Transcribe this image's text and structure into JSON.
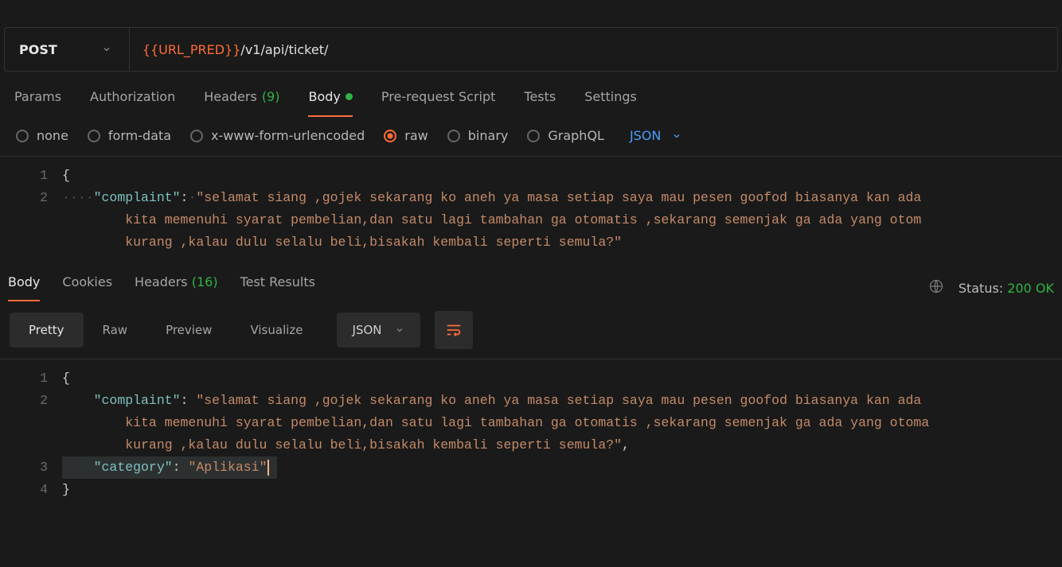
{
  "request": {
    "method": "POST",
    "url_var": "{{URL_PRED}}",
    "url_path": "/v1/api/ticket/"
  },
  "tabs": [
    {
      "label": "Params"
    },
    {
      "label": "Authorization"
    },
    {
      "label": "Headers",
      "count": "(9)"
    },
    {
      "label": "Body",
      "active": true,
      "dot": true
    },
    {
      "label": "Pre-request Script"
    },
    {
      "label": "Tests"
    },
    {
      "label": "Settings"
    }
  ],
  "body_types": [
    {
      "label": "none"
    },
    {
      "label": "form-data"
    },
    {
      "label": "x-www-form-urlencoded"
    },
    {
      "label": "raw",
      "selected": true
    },
    {
      "label": "binary"
    },
    {
      "label": "GraphQL"
    }
  ],
  "format_selector": "JSON",
  "request_body": {
    "lines": [
      "1",
      "2"
    ],
    "key": "\"complaint\"",
    "str_open": "\"selamat siang ,gojek sekarang ko aneh ya masa setiap saya mau pesen goofod biasanya kan ada ",
    "str_cont1": "kita memenuhi syarat pembelian,dan satu lagi tambahan ga otomatis ,sekarang semenjak ga ada yang otom",
    "str_cont2": "kurang ,kalau dulu selalu beli,bisakah kembali seperti semula?\""
  },
  "response_tabs": [
    {
      "label": "Body",
      "active": true
    },
    {
      "label": "Cookies"
    },
    {
      "label": "Headers",
      "count": "(16)"
    },
    {
      "label": "Test Results"
    }
  ],
  "response_status": {
    "label": "Status:",
    "value": "200 OK"
  },
  "view_tabs": [
    {
      "label": "Pretty",
      "active": true
    },
    {
      "label": "Raw"
    },
    {
      "label": "Preview"
    },
    {
      "label": "Visualize"
    }
  ],
  "response_format": "JSON",
  "response_body": {
    "lines": [
      "1",
      "2",
      "3",
      "4"
    ],
    "key1": "\"complaint\"",
    "val1a": "\"selamat siang ,gojek sekarang ko aneh ya masa setiap saya mau pesen goofod biasanya kan ada ",
    "val1b": "kita memenuhi syarat pembelian,dan satu lagi tambahan ga otomatis ,sekarang semenjak ga ada yang otoma",
    "val1c": "kurang ,kalau dulu selalu beli,bisakah kembali seperti semula?\"",
    "key2": "\"category\"",
    "val2": "\"Aplikasi\""
  }
}
